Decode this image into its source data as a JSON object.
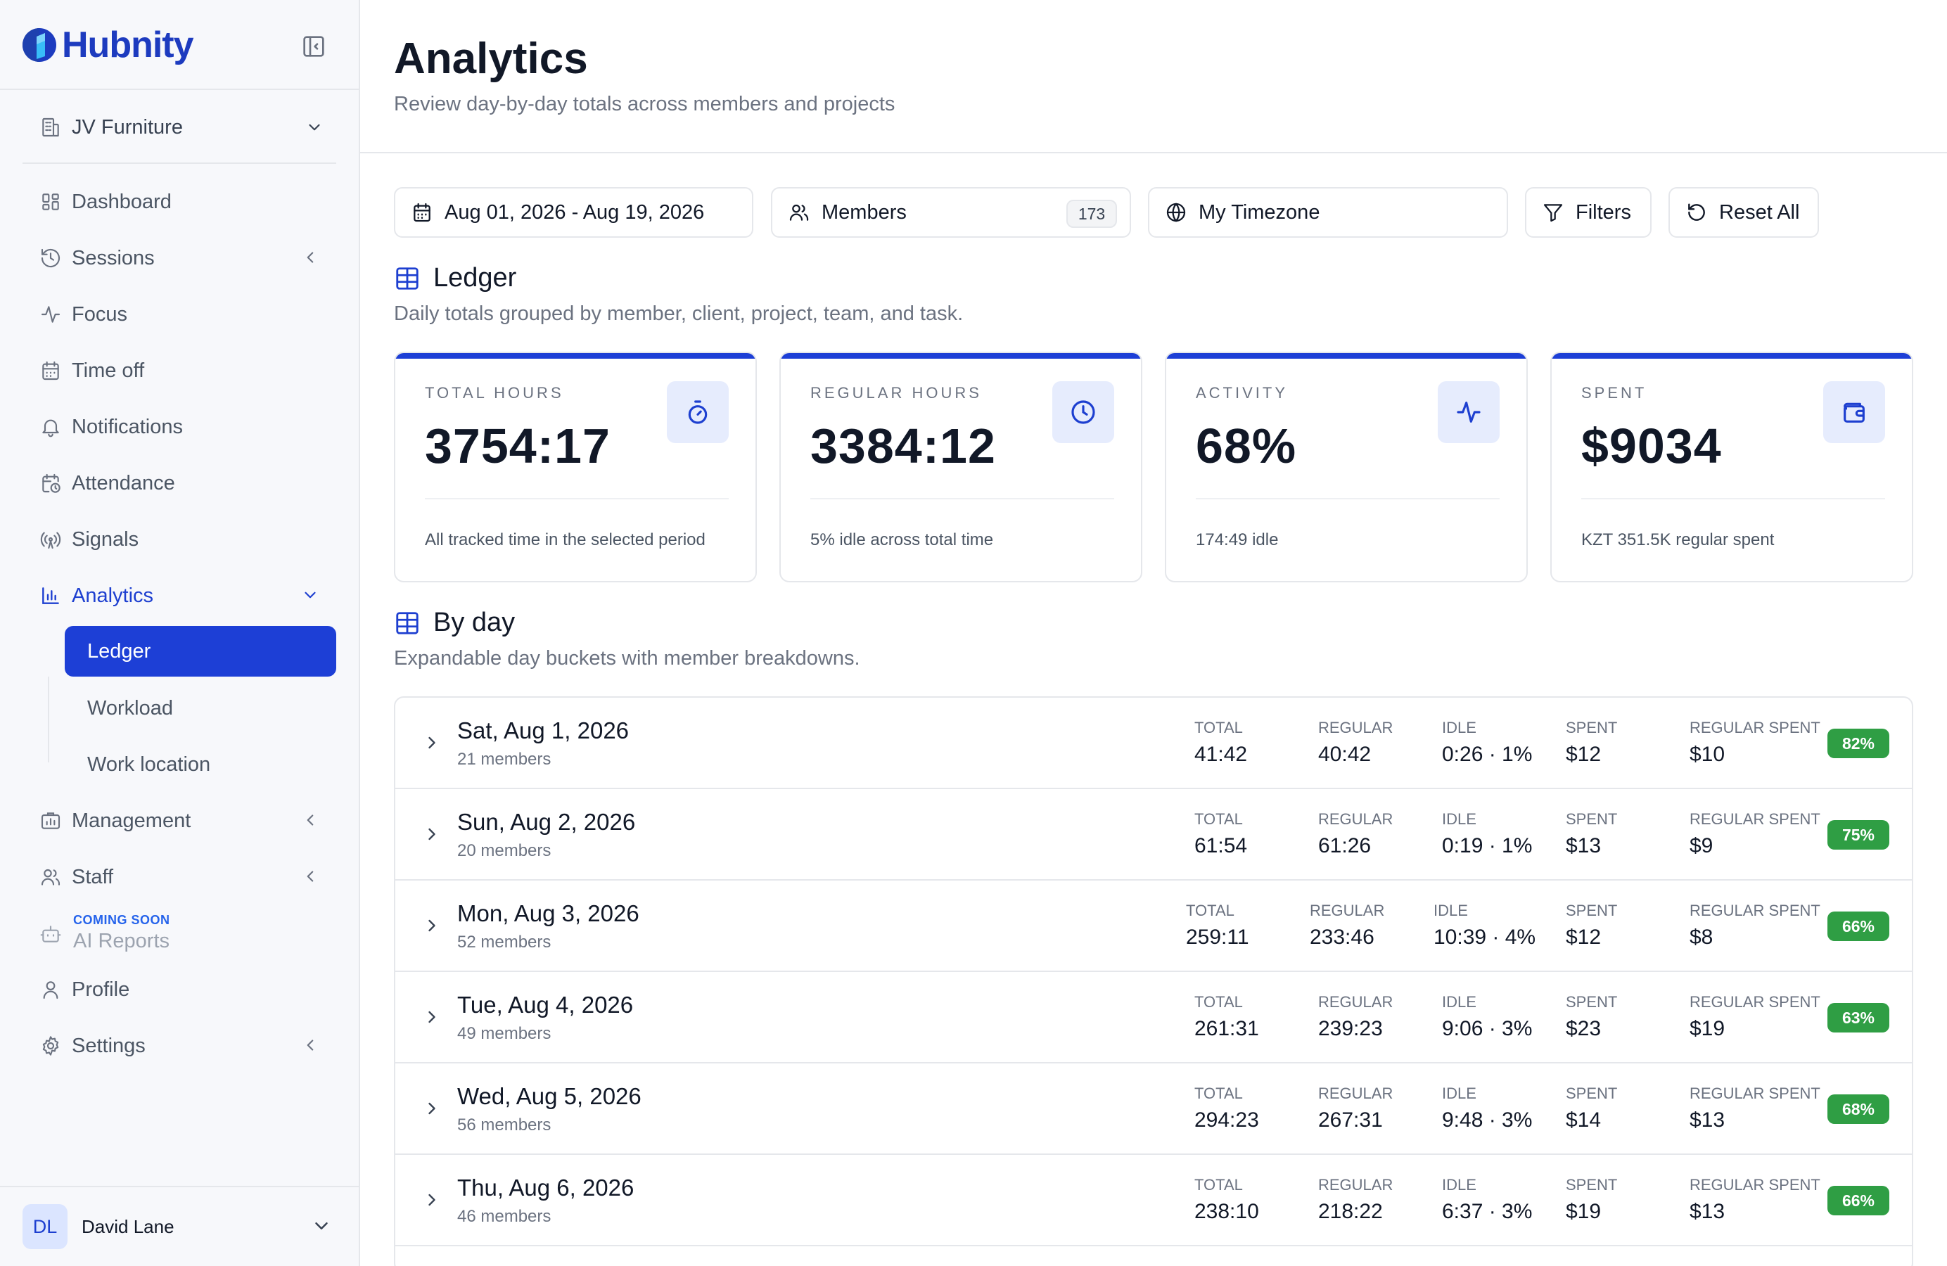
{
  "app": {
    "name": "Hubnity",
    "brand_color": "#1d3bbf",
    "accent_color": "#1d3fd6"
  },
  "sidebar": {
    "workspace": "JV Furniture",
    "nav": {
      "dashboard": "Dashboard",
      "sessions": "Sessions",
      "focus": "Focus",
      "time_off": "Time off",
      "notifications": "Notifications",
      "attendance": "Attendance",
      "signals": "Signals",
      "analytics": "Analytics",
      "management": "Management",
      "staff": "Staff",
      "profile": "Profile",
      "settings": "Settings"
    },
    "analytics_sub": {
      "ledger": "Ledger",
      "workload": "Workload",
      "work_location": "Work location"
    },
    "ai_reports": {
      "badge": "COMING SOON",
      "label": "AI Reports"
    },
    "user": {
      "initials": "DL",
      "name": "David Lane"
    }
  },
  "header": {
    "title": "Analytics",
    "subtitle": "Review day-by-day totals across members and projects"
  },
  "toolbar": {
    "date_range": "Aug 01, 2026 - Aug 19, 2026",
    "members_label": "Members",
    "members_count": "173",
    "timezone": "My Timezone",
    "filters": "Filters",
    "reset_all": "Reset All"
  },
  "ledger": {
    "title": "Ledger",
    "description": "Daily totals grouped by member, client, project, team, and task.",
    "stats": [
      {
        "label": "TOTAL HOURS",
        "value": "3754:17",
        "note": "All tracked time in the selected period",
        "icon": "stopwatch-icon"
      },
      {
        "label": "REGULAR HOURS",
        "value": "3384:12",
        "note": "5% idle across total time",
        "icon": "clock-icon"
      },
      {
        "label": "ACTIVITY",
        "value": "68%",
        "note": "174:49 idle",
        "icon": "activity-icon"
      },
      {
        "label": "SPENT",
        "value": "$9034",
        "note": "KZT 351.5K regular spent",
        "icon": "wallet-icon"
      }
    ]
  },
  "by_day": {
    "title": "By day",
    "description": "Expandable day buckets with member breakdowns.",
    "labels": {
      "total": "TOTAL",
      "regular": "REGULAR",
      "idle": "IDLE",
      "spent": "SPENT",
      "regular_spent": "REGULAR SPENT"
    },
    "days": [
      {
        "date": "Sat, Aug 1, 2026",
        "members": "21 members",
        "total": "41:42",
        "regular": "40:42",
        "idle": "0:26 · 1%",
        "spent": "$12",
        "regular_spent": "$10",
        "activity": "82%"
      },
      {
        "date": "Sun, Aug 2, 2026",
        "members": "20 members",
        "total": "61:54",
        "regular": "61:26",
        "idle": "0:19 · 1%",
        "spent": "$13",
        "regular_spent": "$9",
        "activity": "75%"
      },
      {
        "date": "Mon, Aug 3, 2026",
        "members": "52 members",
        "total": "259:11",
        "regular": "233:46",
        "idle": "10:39 · 4%",
        "spent": "$12",
        "regular_spent": "$8",
        "activity": "66%"
      },
      {
        "date": "Tue, Aug 4, 2026",
        "members": "49 members",
        "total": "261:31",
        "regular": "239:23",
        "idle": "9:06 · 3%",
        "spent": "$23",
        "regular_spent": "$19",
        "activity": "63%"
      },
      {
        "date": "Wed, Aug 5, 2026",
        "members": "56 members",
        "total": "294:23",
        "regular": "267:31",
        "idle": "9:48 · 3%",
        "spent": "$14",
        "regular_spent": "$13",
        "activity": "68%"
      },
      {
        "date": "Thu, Aug 6, 2026",
        "members": "46 members",
        "total": "238:10",
        "regular": "218:22",
        "idle": "6:37 · 3%",
        "spent": "$19",
        "regular_spent": "$13",
        "activity": "66%"
      }
    ]
  }
}
